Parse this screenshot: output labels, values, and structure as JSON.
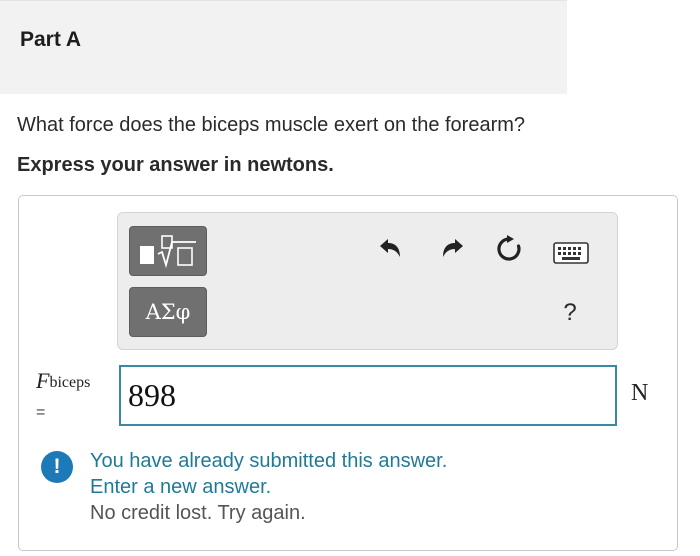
{
  "part": {
    "title": "Part A"
  },
  "question": {
    "text": "What force does the biceps muscle exert on the forearm?",
    "instruction": "Express your answer in newtons."
  },
  "toolbar": {
    "template_icon": "templates-icon",
    "symbols_label": "ΑΣφ",
    "undo_icon": "undo-icon",
    "redo_icon": "redo-icon",
    "reset_icon": "reset-icon",
    "keyboard_icon": "keyboard-icon",
    "help_label": "?"
  },
  "answer": {
    "variable": "F",
    "variable_subscript": "biceps",
    "equals": "=",
    "value": "898",
    "unit": "N"
  },
  "feedback": {
    "line1": "You have already submitted this answer.",
    "line2": "Enter a new answer.",
    "line3": "No credit lost. Try again.",
    "icon": "!"
  },
  "colors": {
    "input_border": "#3a8aa7",
    "feedback_text": "#1f7a99",
    "feedback_icon": "#1d7ab8",
    "toolbar_button": "#707070"
  }
}
